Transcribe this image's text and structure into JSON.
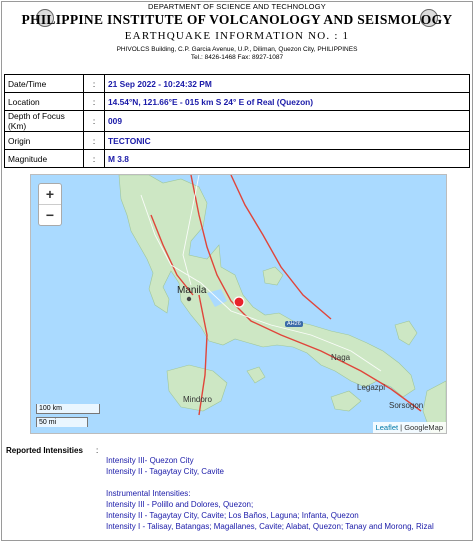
{
  "header": {
    "department": "DEPARTMENT OF SCIENCE AND TECHNOLOGY",
    "institute": "PHILIPPINE INSTITUTE OF VOLCANOLOGY AND SEISMOLOGY",
    "info_title": "EARTHQUAKE INFORMATION NO. :",
    "info_number": "1",
    "address": "PHIVOLCS Building, C.P. Garcia Avenue, U.P., Diliman, Quezon City, PHILIPPINES",
    "telephone": "Tel.: 8426-1468   Fax: 8927-1087"
  },
  "details": [
    {
      "label": "Date/Time",
      "sep": ":",
      "value": "21 Sep 2022 - 10:24:32 PM"
    },
    {
      "label": "Location",
      "sep": ":",
      "value": "14.54°N, 121.66°E - 015 km S 24° E of Real (Quezon)"
    },
    {
      "label": "Depth of Focus (Km)",
      "sep": ":",
      "value": "009"
    },
    {
      "label": "Origin",
      "sep": ":",
      "value": "TECTONIC"
    },
    {
      "label": "Magnitude",
      "sep": ":",
      "value": "M 3.8"
    }
  ],
  "map": {
    "zoom_in": "+",
    "zoom_out": "−",
    "labels": {
      "manila": "Manila",
      "naga": "Naga",
      "legazpi": "Legazpi",
      "sorsogon": "Sorsogon",
      "mindoro": "Mindoro",
      "highway": "AH26"
    },
    "scale_km": "100 km",
    "scale_mi": "50 mi",
    "attribution_leaflet": "Leaflet",
    "attribution_sep": " | ",
    "attribution_google": "GoogleMap",
    "colors": {
      "sea": "#aadaff",
      "land": "#cde7c4",
      "fault": "#e0453a",
      "epicenter": "#e8232a"
    }
  },
  "intensities": {
    "reported_label": "Reported Intensities",
    "sep": ":",
    "reported": [
      "Intensity III- Quezon City",
      "Intensity II - Tagaytay City, Cavite"
    ],
    "instrumental_label": "Instrumental Intensities:",
    "instrumental": [
      "Intensity III - Polillo and Dolores, Quezon;",
      "Intensity II - Tagaytay City, Cavite; Los Baños, Laguna; Infanta, Quezon",
      "Intensity I - Talisay, Batangas; Magallanes, Cavite; Alabat, Quezon; Tanay and Morong, Rizal"
    ]
  }
}
